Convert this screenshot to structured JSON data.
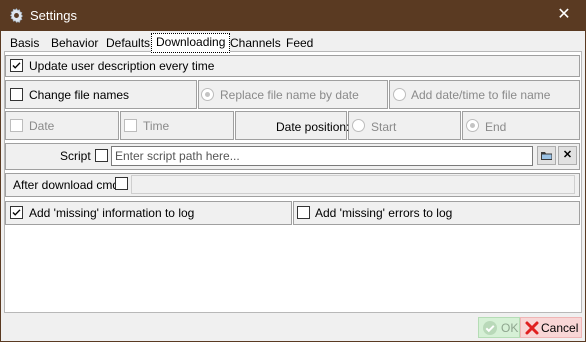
{
  "window": {
    "title": "Settings",
    "close_glyph": "✕",
    "icon": "gear-icon",
    "titlebar_color": "#5a3a22"
  },
  "tabs": [
    {
      "label": "Basis",
      "active": false
    },
    {
      "label": "Behavior",
      "active": false
    },
    {
      "label": "Defaults",
      "active": false
    },
    {
      "label": "Downloading",
      "active": true
    },
    {
      "label": "Channels",
      "active": false
    },
    {
      "label": "Feed",
      "active": false
    }
  ],
  "options": {
    "update_user_description": {
      "label": "Update user description every time",
      "checked": true
    },
    "change_file_names": {
      "label": "Change file names",
      "checked": false
    },
    "replace_file_name_by_date": {
      "label": "Replace file name by date",
      "selected": true,
      "enabled": false
    },
    "add_datetime_to_file_name": {
      "label": "Add date/time to file name",
      "selected": false,
      "enabled": false
    },
    "date": {
      "label": "Date",
      "checked": false,
      "enabled": false
    },
    "time": {
      "label": "Time",
      "checked": false,
      "enabled": false
    },
    "date_position": {
      "label": "Date position:",
      "start_label": "Start",
      "end_label": "End",
      "selected": "End"
    },
    "script": {
      "label": "Script",
      "checked": false,
      "placeholder": "Enter script path here...",
      "value": "",
      "clear_glyph": "✕"
    },
    "after_download_cmd": {
      "label": "After download cmd",
      "checked": false,
      "value": ""
    },
    "add_missing_info_to_log": {
      "label": "Add 'missing' information to log",
      "checked": true
    },
    "add_missing_errors_to_log": {
      "label": "Add 'missing' errors to log",
      "checked": false
    }
  },
  "footer": {
    "ok_label": "OK",
    "cancel_label": "Cancel",
    "ok_color": "#d6f0d6",
    "cancel_color": "#f8d6d6"
  }
}
